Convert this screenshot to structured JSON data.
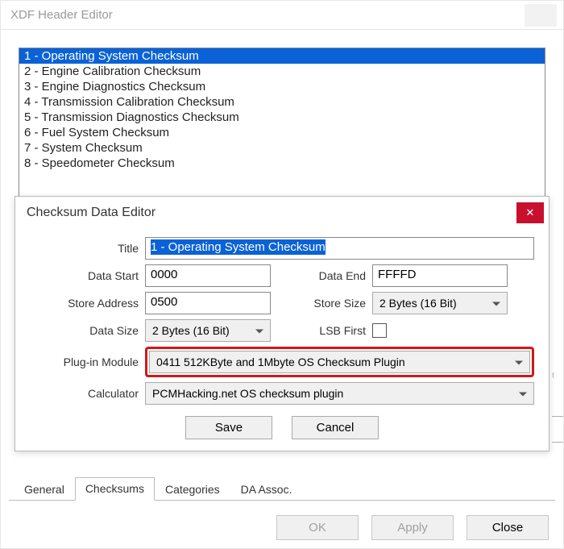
{
  "outer": {
    "title": "XDF Header Editor",
    "items": [
      "1 - Operating System Checksum",
      "2 - Engine Calibration Checksum",
      "3 - Engine Diagnostics Checksum",
      "4 - Transmission Calibration Checksum",
      "5 - Transmission Diagnostics Checksum",
      "6 - Fuel System Checksum",
      "7 - System Checksum",
      "8 - Speedometer Checksum"
    ],
    "selected_index": 0,
    "tabs": [
      "General",
      "Checksums",
      "Categories",
      "DA Assoc."
    ],
    "active_tab_index": 1,
    "ok": "OK",
    "apply": "Apply",
    "close": "Close"
  },
  "inner": {
    "title": "Checksum Data Editor",
    "labels": {
      "title": "Title",
      "data_start": "Data Start",
      "data_end": "Data End",
      "store_address": "Store Address",
      "store_size": "Store Size",
      "data_size": "Data Size",
      "lsb_first": "LSB First",
      "plugin": "Plug-in Module",
      "calculator": "Calculator"
    },
    "values": {
      "title": "1 - Operating System Checksum",
      "data_start": "0000",
      "data_end": "FFFFD",
      "store_address": "0500",
      "store_size": "2 Bytes (16 Bit)",
      "data_size": "2 Bytes (16 Bit)",
      "lsb_first": false,
      "plugin": "0411 512KByte and 1Mbyte OS Checksum Plugin",
      "calculator": "PCMHacking.net OS checksum plugin"
    },
    "save": "Save",
    "cancel": "Cancel"
  }
}
